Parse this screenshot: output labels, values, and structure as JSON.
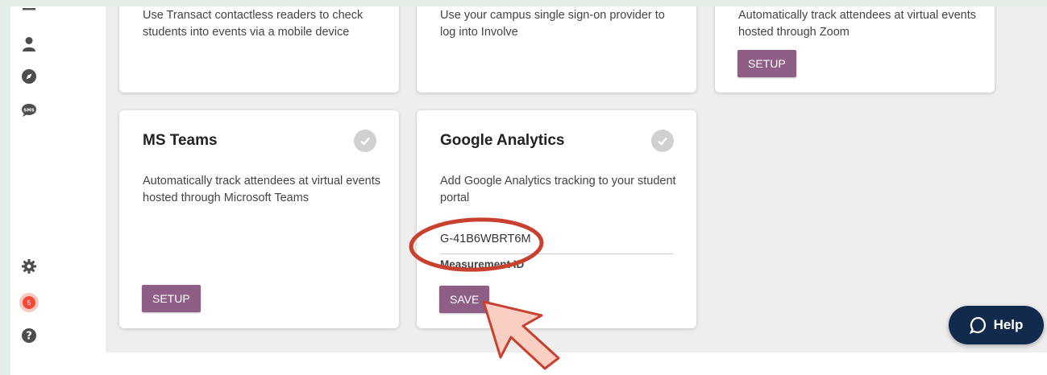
{
  "cards_top": [
    {
      "desc": "Use Transact contactless readers to check students into events via a mobile device"
    },
    {
      "desc": "Use your campus single sign-on provider to log into Involve"
    },
    {
      "desc": "Automatically track attendees at virtual events hosted through Zoom",
      "button": "SETUP"
    }
  ],
  "ms_teams": {
    "title": "MS Teams",
    "desc": "Automatically track attendees at virtual events hosted through Microsoft Teams",
    "button": "SETUP"
  },
  "google_analytics": {
    "title": "Google Analytics",
    "desc": "Add Google Analytics tracking to your student portal",
    "measurement_id_value": "G-41B6WBRT6M",
    "measurement_id_label": "Measurement ID",
    "button": "SAVE"
  },
  "sidebar": {
    "notification_count": "5"
  },
  "help": {
    "label": "Help"
  },
  "colors": {
    "button_purple": "#8e5e87",
    "help_navy": "#122a4b",
    "annotation_red": "#c8412f",
    "badge_red": "#f04a3a"
  }
}
